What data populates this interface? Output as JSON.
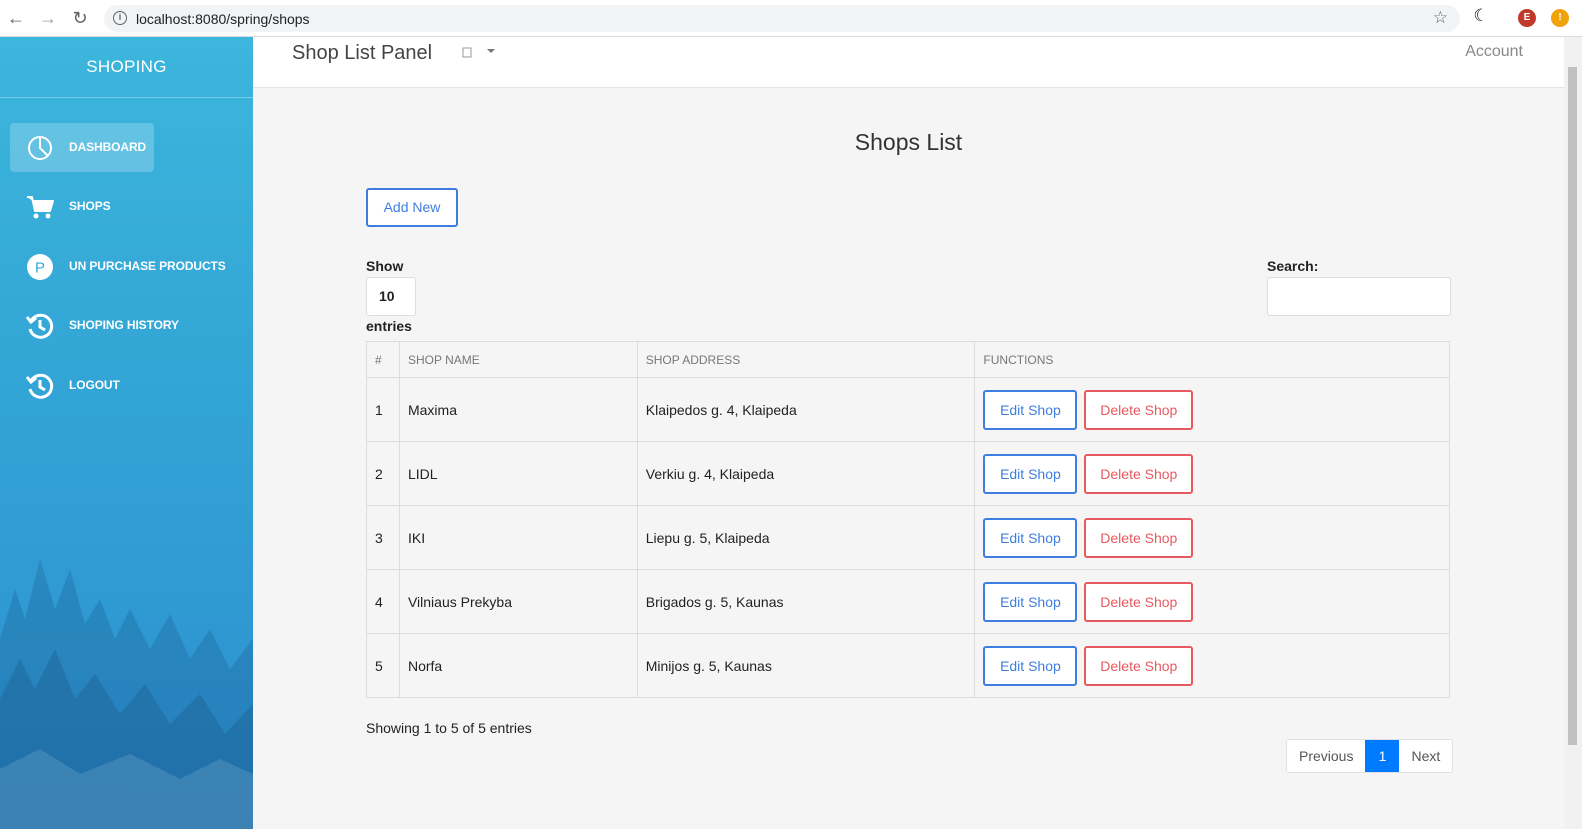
{
  "browser": {
    "back": "←",
    "forward": "→",
    "reload": "↻",
    "info": "i",
    "url": "localhost:8080/spring/shops",
    "star": "☆",
    "ext_moon": "☾",
    "ext_avatar": "E",
    "ext_alert": "!"
  },
  "sidebar": {
    "brand": "SHOPING",
    "items": [
      {
        "label": "DASHBOARD",
        "icon": "pie-chart-icon",
        "active": true
      },
      {
        "label": "SHOPS",
        "icon": "cart-icon"
      },
      {
        "label": "UN PURCHASE PRODUCTS",
        "icon": "parking-p-icon"
      },
      {
        "label": "SHOPING HISTORY",
        "icon": "history-icon"
      },
      {
        "label": "LOGOUT",
        "icon": "history-icon"
      }
    ]
  },
  "topbar": {
    "title": "Shop List Panel",
    "account": "Account"
  },
  "page": {
    "title": "Shops List",
    "add_new": "Add New",
    "show_label": "Show",
    "show_value": "10",
    "entries_label": "entries",
    "search_label": "Search:",
    "search_value": ""
  },
  "table": {
    "headers": [
      "#",
      "SHOP NAME",
      "SHOP ADDRESS",
      "FUNCTIONS"
    ],
    "rows": [
      {
        "num": "1",
        "name": "Maxima",
        "address": "Klaipedos g. 4, Klaipeda"
      },
      {
        "num": "2",
        "name": "LIDL",
        "address": "Verkiu g. 4, Klaipeda"
      },
      {
        "num": "3",
        "name": "IKI",
        "address": "Liepu g. 5, Klaipeda"
      },
      {
        "num": "4",
        "name": "Vilniaus Prekyba",
        "address": "Brigados g. 5, Kaunas"
      },
      {
        "num": "5",
        "name": "Norfa",
        "address": "Minijos g. 5, Kaunas"
      }
    ],
    "edit_label": "Edit Shop",
    "delete_label": "Delete Shop"
  },
  "footer": {
    "info": "Showing 1 to 5 of 5 entries",
    "previous": "Previous",
    "current_page": "1",
    "next": "Next"
  },
  "colors": {
    "primary": "#3f7de0",
    "danger": "#e8595f",
    "pager_active": "#007bff",
    "sidebar_top": "#3cb6dc",
    "sidebar_bottom": "#2c8ece"
  }
}
